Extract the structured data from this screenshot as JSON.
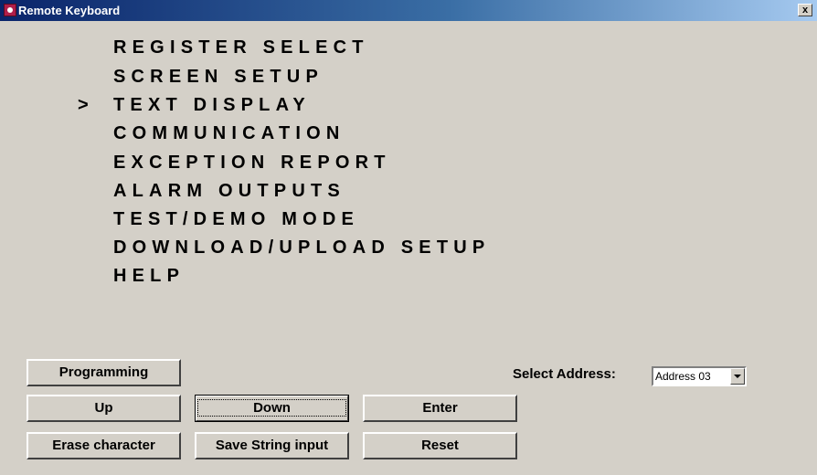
{
  "window": {
    "title": "Remote Keyboard",
    "close_label": "x"
  },
  "display": {
    "cursor": ">",
    "selected_index": 2,
    "items": [
      "REGISTER SELECT",
      "SCREEN SETUP",
      "TEXT DISPLAY",
      "COMMUNICATION",
      "EXCEPTION REPORT",
      "ALARM OUTPUTS",
      "TEST/DEMO MODE",
      "DOWNLOAD/UPLOAD SETUP",
      "HELP"
    ]
  },
  "buttons": {
    "programming": "Programming",
    "up": "Up",
    "down": "Down",
    "enter": "Enter",
    "erase": "Erase character",
    "save": "Save String input",
    "reset": "Reset"
  },
  "address": {
    "label": "Select Address:",
    "selected": "Address 03"
  }
}
